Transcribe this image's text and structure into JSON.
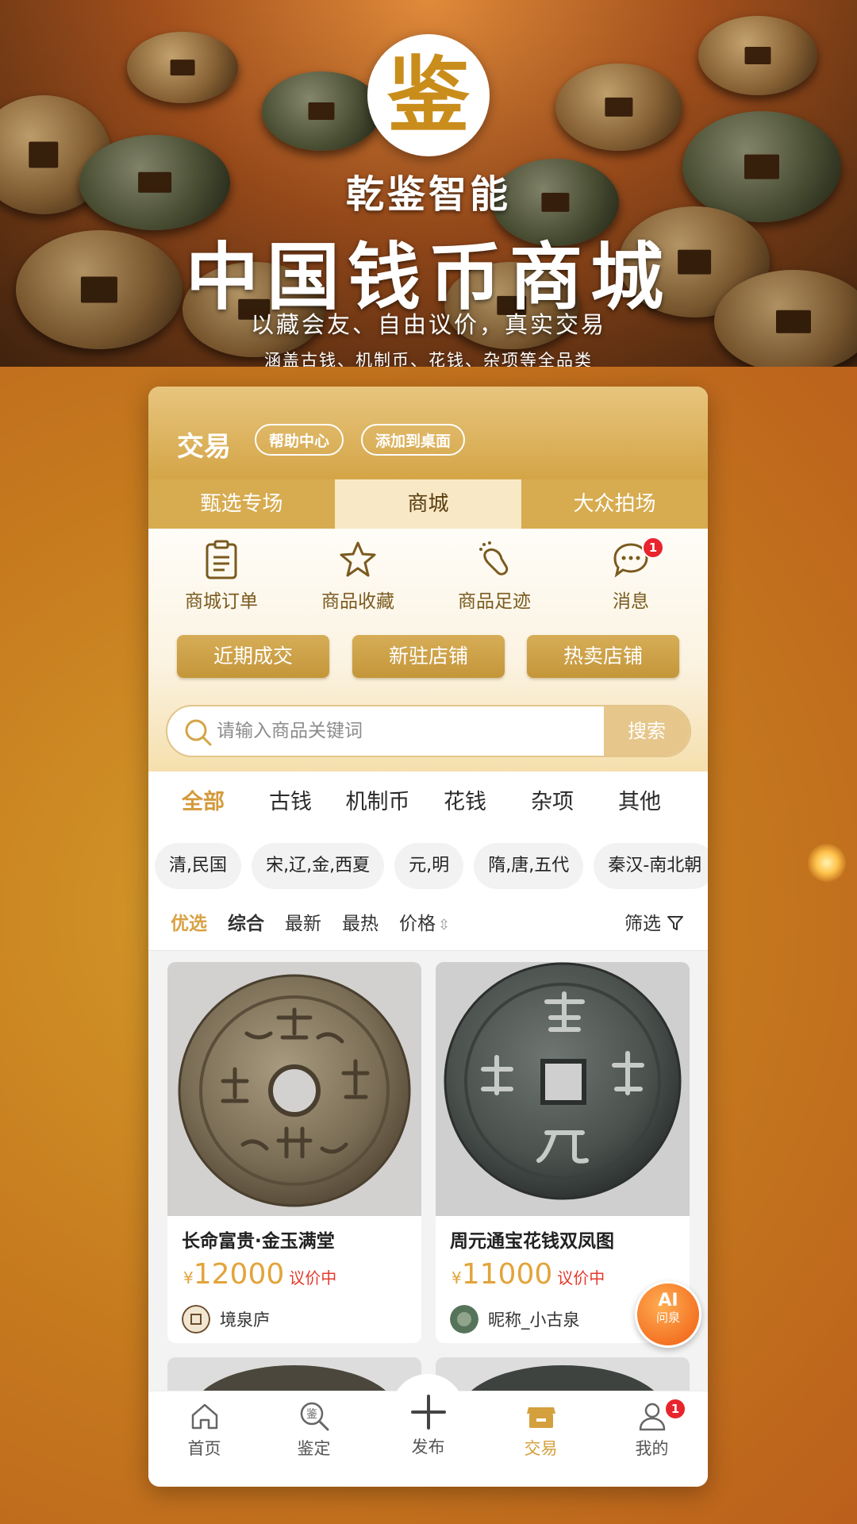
{
  "hero": {
    "logo_char": "鉴",
    "brand_name": "乾鉴智能",
    "title": "中国钱币商城",
    "slogan": "以藏会友、自由议价，真实交易",
    "subtitle": "涵盖古钱、机制币、花钱、杂项等全品类"
  },
  "header": {
    "title": "交易",
    "help_center": "帮助中心",
    "add_to_desktop": "添加到桌面"
  },
  "tabs": [
    {
      "label": "甄选专场",
      "active": false
    },
    {
      "label": "商城",
      "active": true
    },
    {
      "label": "大众拍场",
      "active": false
    }
  ],
  "quick_icons": [
    {
      "label": "商城订单",
      "icon": "clipboard-icon"
    },
    {
      "label": "商品收藏",
      "icon": "star-icon"
    },
    {
      "label": "商品足迹",
      "icon": "footprint-icon"
    },
    {
      "label": "消息",
      "icon": "chat-icon",
      "badge": "1"
    }
  ],
  "quick_buttons": [
    "近期成交",
    "新驻店铺",
    "热卖店铺"
  ],
  "search": {
    "placeholder": "请输入商品关键词",
    "button": "搜索"
  },
  "categories": [
    {
      "label": "全部",
      "active": true
    },
    {
      "label": "古钱"
    },
    {
      "label": "机制币"
    },
    {
      "label": "花钱"
    },
    {
      "label": "杂项"
    },
    {
      "label": "其他"
    }
  ],
  "subcategories": [
    "清,民国",
    "宋,辽,金,西夏",
    "元,明",
    "隋,唐,五代",
    "秦汉-南北朝"
  ],
  "filters": {
    "selected": "优选",
    "overall": "综合",
    "newest": "最新",
    "hottest": "最热",
    "price": "价格",
    "price_icon": "⇳",
    "screen": "筛选"
  },
  "products": [
    {
      "name": "长命富贵·金玉满堂",
      "currency": "¥",
      "price": "12000",
      "status": "议价中",
      "seller": "境泉庐"
    },
    {
      "name": "周元通宝花钱双凤图",
      "currency": "¥",
      "price": "11000",
      "status": "议价中",
      "seller": "昵称_小古泉"
    }
  ],
  "ai_button": {
    "line1": "AI",
    "line2": "问泉"
  },
  "bottom_nav": [
    {
      "label": "首页",
      "icon": "home-icon"
    },
    {
      "label": "鉴定",
      "icon": "appraise-icon"
    },
    {
      "label": "发布",
      "icon": "plus-icon"
    },
    {
      "label": "交易",
      "icon": "shop-icon",
      "active": true
    },
    {
      "label": "我的",
      "icon": "user-icon",
      "badge": "1"
    }
  ],
  "colors": {
    "accent_gold": "#d4a547",
    "price": "#e2a43a",
    "status_red": "#e43a2e",
    "badge_red": "#e8242d",
    "ai_orange": "#f37021"
  }
}
